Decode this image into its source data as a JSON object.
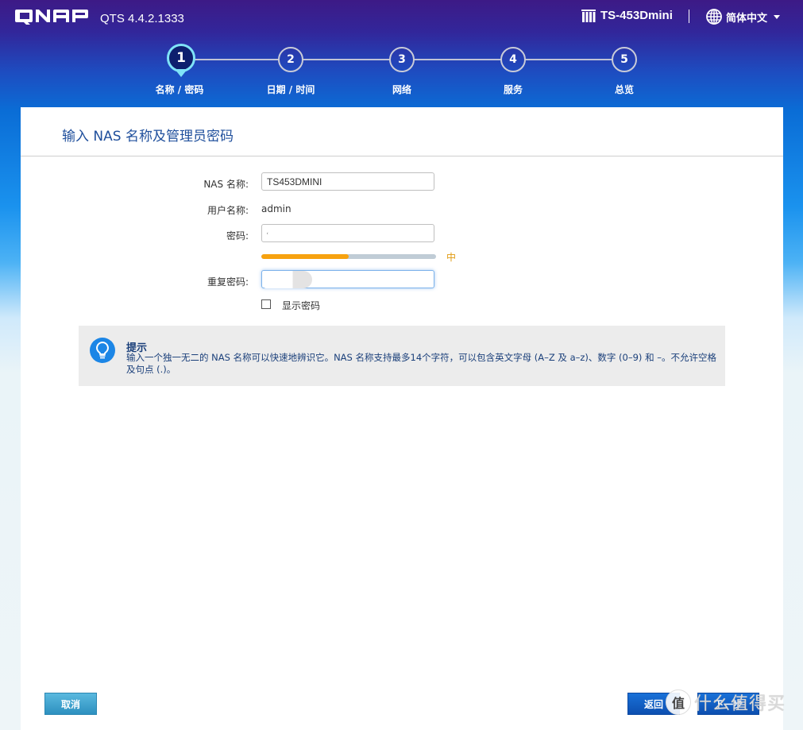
{
  "header": {
    "brand": "QNAP",
    "version": "QTS 4.4.2.1333",
    "device_icon": "nas-device-icon",
    "device_name": "TS-453Dmini",
    "language_icon": "globe-icon",
    "language": "简体中文"
  },
  "wizard": {
    "current_step": 1,
    "steps": [
      {
        "number": "1",
        "label": "名称 / 密码"
      },
      {
        "number": "2",
        "label": "日期 / 时间"
      },
      {
        "number": "3",
        "label": "网络"
      },
      {
        "number": "4",
        "label": "服务"
      },
      {
        "number": "5",
        "label": "总览"
      }
    ]
  },
  "panel": {
    "title": "输入 NAS 名称及管理员密码",
    "form": {
      "nas_name_label": "NAS 名称:",
      "nas_name_value": "TS453DMINI",
      "username_label": "用户名称:",
      "username_value": "admin",
      "password_label": "密码:",
      "password_strength_fraction": 0.5,
      "password_strength_label": "中",
      "repeat_password_label": "重复密码:",
      "show_password_label": "显示密码",
      "show_password_checked": false
    },
    "tip": {
      "icon": "lightbulb-icon",
      "title": "提示",
      "text": "输入一个独一无二的 NAS 名称可以快速地辨识它。NAS 名称支持最多14个字符，可以包含英文字母 (A–Z 及 a–z)、数字 (0–9) 和 –。不允许空格及句点 (.)。"
    }
  },
  "footer": {
    "cancel": "取消",
    "back": "返回",
    "next": "下一步"
  },
  "watermark": {
    "badge": "值",
    "text": "什么值得买"
  },
  "colors": {
    "accent_blue": "#1f4f9c",
    "strength_medium": "#f7a20f",
    "active_step": "#7fe3f7"
  }
}
